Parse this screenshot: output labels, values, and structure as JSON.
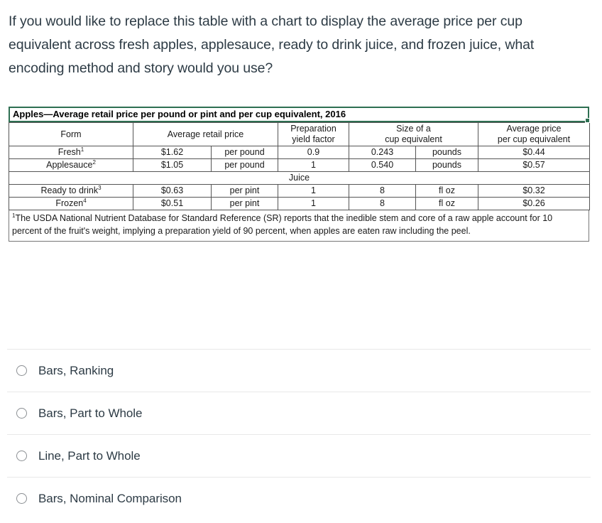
{
  "question": {
    "prompt": "If you would like to replace this table with a chart to display the average price per cup equivalent across fresh apples, applesauce, ready to drink juice, and frozen juice, what encoding method and story would you use?"
  },
  "table": {
    "title": "Apples—Average retail price per pound or pint and per cup equivalent, 2016",
    "selection_border_color": "#2e6f52",
    "headers": {
      "form": "Form",
      "average_retail_price": "Average retail price",
      "preparation_yield_factor_l1": "Preparation",
      "preparation_yield_factor_l2": "yield factor",
      "size_of_cup_equivalent_l1": "Size of a",
      "size_of_cup_equivalent_l2": "cup equivalent",
      "average_price_per_cup_l1": "Average price",
      "average_price_per_cup_l2": "per cup equivalent"
    },
    "rows": [
      {
        "form": "Fresh",
        "form_sup": "1",
        "price": "$1.62",
        "price_unit": "per pound",
        "yield_factor": "0.9",
        "cup_size": "0.243",
        "cup_unit": "pounds",
        "price_per_cup": "$0.44"
      },
      {
        "form": "Applesauce",
        "form_sup": "2",
        "price": "$1.05",
        "price_unit": "per pound",
        "yield_factor": "1",
        "cup_size": "0.540",
        "cup_unit": "pounds",
        "price_per_cup": "$0.57"
      }
    ],
    "group_label": "Juice",
    "juice_rows": [
      {
        "form": "Ready to drink",
        "form_sup": "3",
        "price": "$0.63",
        "price_unit": "per pint",
        "yield_factor": "1",
        "cup_size": "8",
        "cup_unit": "fl oz",
        "price_per_cup": "$0.32"
      },
      {
        "form": "Frozen",
        "form_sup": "4",
        "price": "$0.51",
        "price_unit": "per pint",
        "yield_factor": "1",
        "cup_size": "8",
        "cup_unit": "fl oz",
        "price_per_cup": "$0.26"
      }
    ],
    "footnote_marker": "1",
    "footnote": "The USDA National Nutrient Database for Standard Reference (SR) reports that the inedible stem and core of a raw apple account for 10 percent of the fruit's weight, implying a preparation yield of 90 percent, when apples are eaten raw including the peel."
  },
  "options": [
    {
      "label": "Bars, Ranking",
      "selected": false
    },
    {
      "label": "Bars, Part to Whole",
      "selected": false
    },
    {
      "label": "Line, Part to Whole",
      "selected": false
    },
    {
      "label": "Bars, Nominal Comparison",
      "selected": false
    }
  ],
  "chart_data": {
    "type": "table",
    "title": "Apples—Average retail price per pound or pint and per cup equivalent, 2016",
    "columns": [
      "Form",
      "Average retail price",
      "Preparation yield factor",
      "Size of a cup equivalent",
      "Average price per cup equivalent"
    ],
    "categories": [
      "Fresh",
      "Applesauce",
      "Ready to drink",
      "Frozen"
    ],
    "values": [
      0.44,
      0.57,
      0.32,
      0.26
    ],
    "ylabel": "Average price per cup equivalent ($)",
    "xlabel": "Form",
    "series": [
      {
        "name": "Average retail price",
        "values": [
          1.62,
          1.05,
          0.63,
          0.51
        ]
      },
      {
        "name": "Preparation yield factor",
        "values": [
          0.9,
          1,
          1,
          1
        ]
      },
      {
        "name": "Size of a cup equivalent",
        "values": [
          0.243,
          0.54,
          8,
          8
        ]
      },
      {
        "name": "Average price per cup equivalent",
        "values": [
          0.44,
          0.57,
          0.32,
          0.26
        ]
      }
    ],
    "units": {
      "Average retail price": [
        "per pound",
        "per pound",
        "per pint",
        "per pint"
      ],
      "Size of a cup equivalent": [
        "pounds",
        "pounds",
        "fl oz",
        "fl oz"
      ]
    }
  }
}
